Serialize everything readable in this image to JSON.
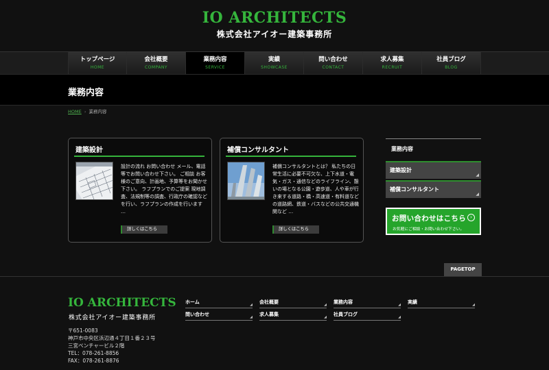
{
  "colors": {
    "brand": "#35b53c",
    "accent_green": "#25a52b",
    "background": "#111111"
  },
  "header": {
    "logo_en": "IO ARCHITECTS",
    "logo_jp": "株式会社アイオー建築事務所"
  },
  "nav": {
    "items": [
      {
        "jp": "トップページ",
        "en": "HOME"
      },
      {
        "jp": "会社概要",
        "en": "COMPANY"
      },
      {
        "jp": "業務内容",
        "en": "SERVICE",
        "active": true
      },
      {
        "jp": "実績",
        "en": "SHOWCASE"
      },
      {
        "jp": "問い合わせ",
        "en": "CONTACT"
      },
      {
        "jp": "求人募集",
        "en": "RECRUIT"
      },
      {
        "jp": "社員ブログ",
        "en": "BLOG"
      }
    ]
  },
  "page_title": "業務内容",
  "breadcrumb": {
    "home": "HOME",
    "separator": "›",
    "current": "業務内容"
  },
  "cards": [
    {
      "title": "建築設計",
      "text": "設計の流れ お問い合わせ メール、電話等でお問い合わせ下さい。 ご相談 お客様のご意向、計画地、予算等をお聞かせ下さい。 ラフプランでのご提案 現地調査、法規制等の調査、行政庁の確認などを行い、ラフプランの作成を行います …",
      "button": "詳しくはこちら",
      "thumb_icon": "blueprint-photo"
    },
    {
      "title": "補償コンサルタント",
      "text": "補償コンサルタントとは？ 私たちの日常生活に必要不可欠な、上下水道・電気・ガス・通信などのライフライン、憩いの場となる公園・遊歩道、人や車が行き来する道路・橋・高速道・有料道などの道路網、鉄道・バスなどの公共交通機関など …",
      "button": "詳しくはこちら",
      "thumb_icon": "building-photo"
    }
  ],
  "sidebar": {
    "heading": "業務内容",
    "items": [
      {
        "label": "建築設計"
      },
      {
        "label": "補償コンサルタント"
      }
    ],
    "contact_main": "お問い合わせはこちら",
    "contact_arrow": "›",
    "contact_sub": "お気軽にご相談・お問い合わせ下さい。"
  },
  "pagetop": "PAGETOP",
  "footer": {
    "logo_en": "IO ARCHITECTS",
    "logo_jp": "株式会社アイオー建築事務所",
    "address": [
      "〒651-0083",
      "神戸市中央区浜辺通４丁目１番２３号",
      "三宮ベンチャービル２階",
      "TEL：078-261-8856",
      "FAX：078-261-8876"
    ],
    "links": [
      {
        "label": "ホーム"
      },
      {
        "label": "会社概要"
      },
      {
        "label": "業務内容"
      },
      {
        "label": "実績"
      },
      {
        "label": "問い合わせ"
      },
      {
        "label": "求人募集"
      },
      {
        "label": "社員ブログ"
      }
    ]
  }
}
